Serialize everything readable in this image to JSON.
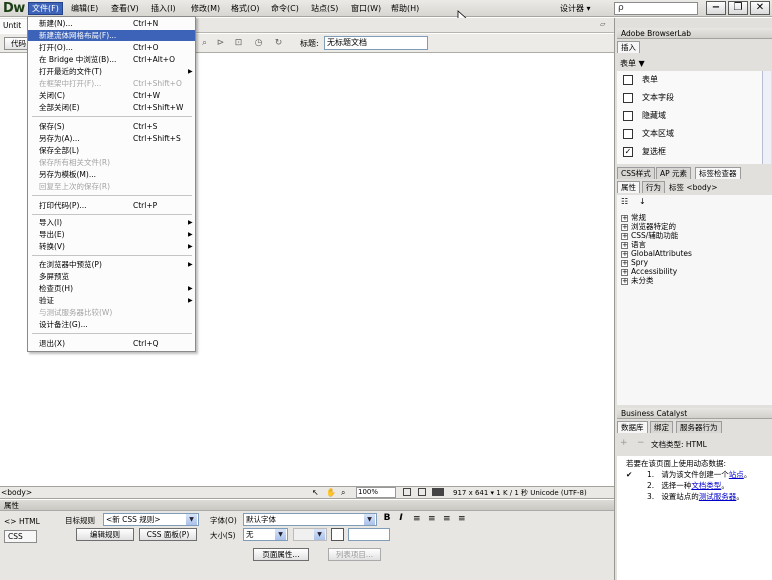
{
  "app": {
    "logo": "Dw",
    "designer": "设计器 ▾"
  },
  "menubar": {
    "items": [
      "文件(F)",
      "编辑(E)",
      "查看(V)",
      "插入(I)",
      "修改(M)",
      "格式(O)",
      "命令(C)",
      "站点(S)",
      "窗口(W)",
      "帮助(H)"
    ]
  },
  "search": {
    "icon": "ρ"
  },
  "window_controls": {
    "min": "−",
    "max": "❐",
    "close": "✕"
  },
  "document": {
    "tab": "Untit",
    "code_button": "代码",
    "title_label": "标题:",
    "title_value": "无标题文档"
  },
  "file_menu": {
    "items": [
      {
        "label": "新建(N)...",
        "shortcut": "Ctrl+N",
        "state": "normal"
      },
      {
        "label": "新建流体网格布局(F)...",
        "shortcut": "",
        "state": "highlight"
      },
      {
        "label": "打开(O)...",
        "shortcut": "Ctrl+O",
        "state": "normal"
      },
      {
        "label": "在 Bridge 中浏览(B)...",
        "shortcut": "Ctrl+Alt+O",
        "state": "normal"
      },
      {
        "label": "打开最近的文件(T)",
        "shortcut": "",
        "state": "submenu"
      },
      {
        "label": "在框架中打开(F)...",
        "shortcut": "Ctrl+Shift+O",
        "state": "disabled"
      },
      {
        "label": "关闭(C)",
        "shortcut": "Ctrl+W",
        "state": "normal"
      },
      {
        "label": "全部关闭(E)",
        "shortcut": "Ctrl+Shift+W",
        "state": "normal"
      },
      {
        "label": "保存(S)",
        "shortcut": "Ctrl+S",
        "state": "normal"
      },
      {
        "label": "另存为(A)...",
        "shortcut": "Ctrl+Shift+S",
        "state": "normal"
      },
      {
        "label": "保存全部(L)",
        "shortcut": "",
        "state": "normal"
      },
      {
        "label": "保存所有相关文件(R)",
        "shortcut": "",
        "state": "disabled"
      },
      {
        "label": "另存为模板(M)...",
        "shortcut": "",
        "state": "normal"
      },
      {
        "label": "回复至上次的保存(R)",
        "shortcut": "",
        "state": "disabled"
      },
      {
        "label": "打印代码(P)...",
        "shortcut": "Ctrl+P",
        "state": "normal"
      },
      {
        "label": "导入(I)",
        "shortcut": "",
        "state": "submenu"
      },
      {
        "label": "导出(E)",
        "shortcut": "",
        "state": "submenu"
      },
      {
        "label": "转换(V)",
        "shortcut": "",
        "state": "submenu"
      },
      {
        "label": "在浏览器中预览(P)",
        "shortcut": "",
        "state": "submenu"
      },
      {
        "label": "多屏预览",
        "shortcut": "",
        "state": "normal"
      },
      {
        "label": "检查页(H)",
        "shortcut": "",
        "state": "submenu"
      },
      {
        "label": "验证",
        "shortcut": "",
        "state": "submenu"
      },
      {
        "label": "与测试服务器比较(W)",
        "shortcut": "",
        "state": "disabled"
      },
      {
        "label": "设计备注(G)...",
        "shortcut": "",
        "state": "normal"
      },
      {
        "label": "退出(X)",
        "shortcut": "Ctrl+Q",
        "state": "normal"
      }
    ]
  },
  "statusbar": {
    "tag": "<body>",
    "zoom": "100%",
    "dims": "917 x 641 ▾  1 K / 1 秒  Unicode (UTF-8)"
  },
  "properties": {
    "title": "属性",
    "html_tab": "<> HTML",
    "css_tab": "CSS",
    "target_rule_label": "目标规则",
    "target_rule_value": "<新 CSS 规则>",
    "edit_rule_button": "编辑规则",
    "css_panel_button": "CSS 面板(P)",
    "font_label": "字体(O)",
    "font_value": "默认字体",
    "size_label": "大小(S)",
    "size_value": "无",
    "bold": "B",
    "italic": "I",
    "page_props_button": "页面属性...",
    "list_item_button": "列表项目..."
  },
  "right_panel": {
    "browserlab_title": "Adobe BrowserLab",
    "insert_tab": "插入",
    "category": "表单 ▼",
    "insert_items": [
      "表单",
      "文本字段",
      "隐藏域",
      "文本区域",
      "复选框"
    ],
    "css_tabs": [
      "CSS样式",
      "AP 元素",
      "标签检查器"
    ],
    "prop_tabs": [
      "属性",
      "行为"
    ],
    "tag_label": "标签 <body>",
    "tree": [
      "常规",
      "浏览器特定的",
      "CSS/辅助功能",
      "语言",
      "GlobalAttributes",
      "Spry",
      "Accessibility",
      "未分类"
    ],
    "bc_title": "Business Catalyst",
    "db_tabs": [
      "数据库",
      "绑定",
      "服务器行为"
    ],
    "doctype_label": "文档类型: HTML",
    "dyn_intro": "若要在该页面上使用动态数据:",
    "steps": [
      {
        "n": "1.",
        "pre": "请为该文件创建一个",
        "link": "站点",
        "post": "。"
      },
      {
        "n": "2.",
        "pre": "选择一种",
        "link": "文档类型",
        "post": "。"
      },
      {
        "n": "3.",
        "pre": "设置站点的",
        "link": "测试服务器",
        "post": "。"
      }
    ]
  }
}
